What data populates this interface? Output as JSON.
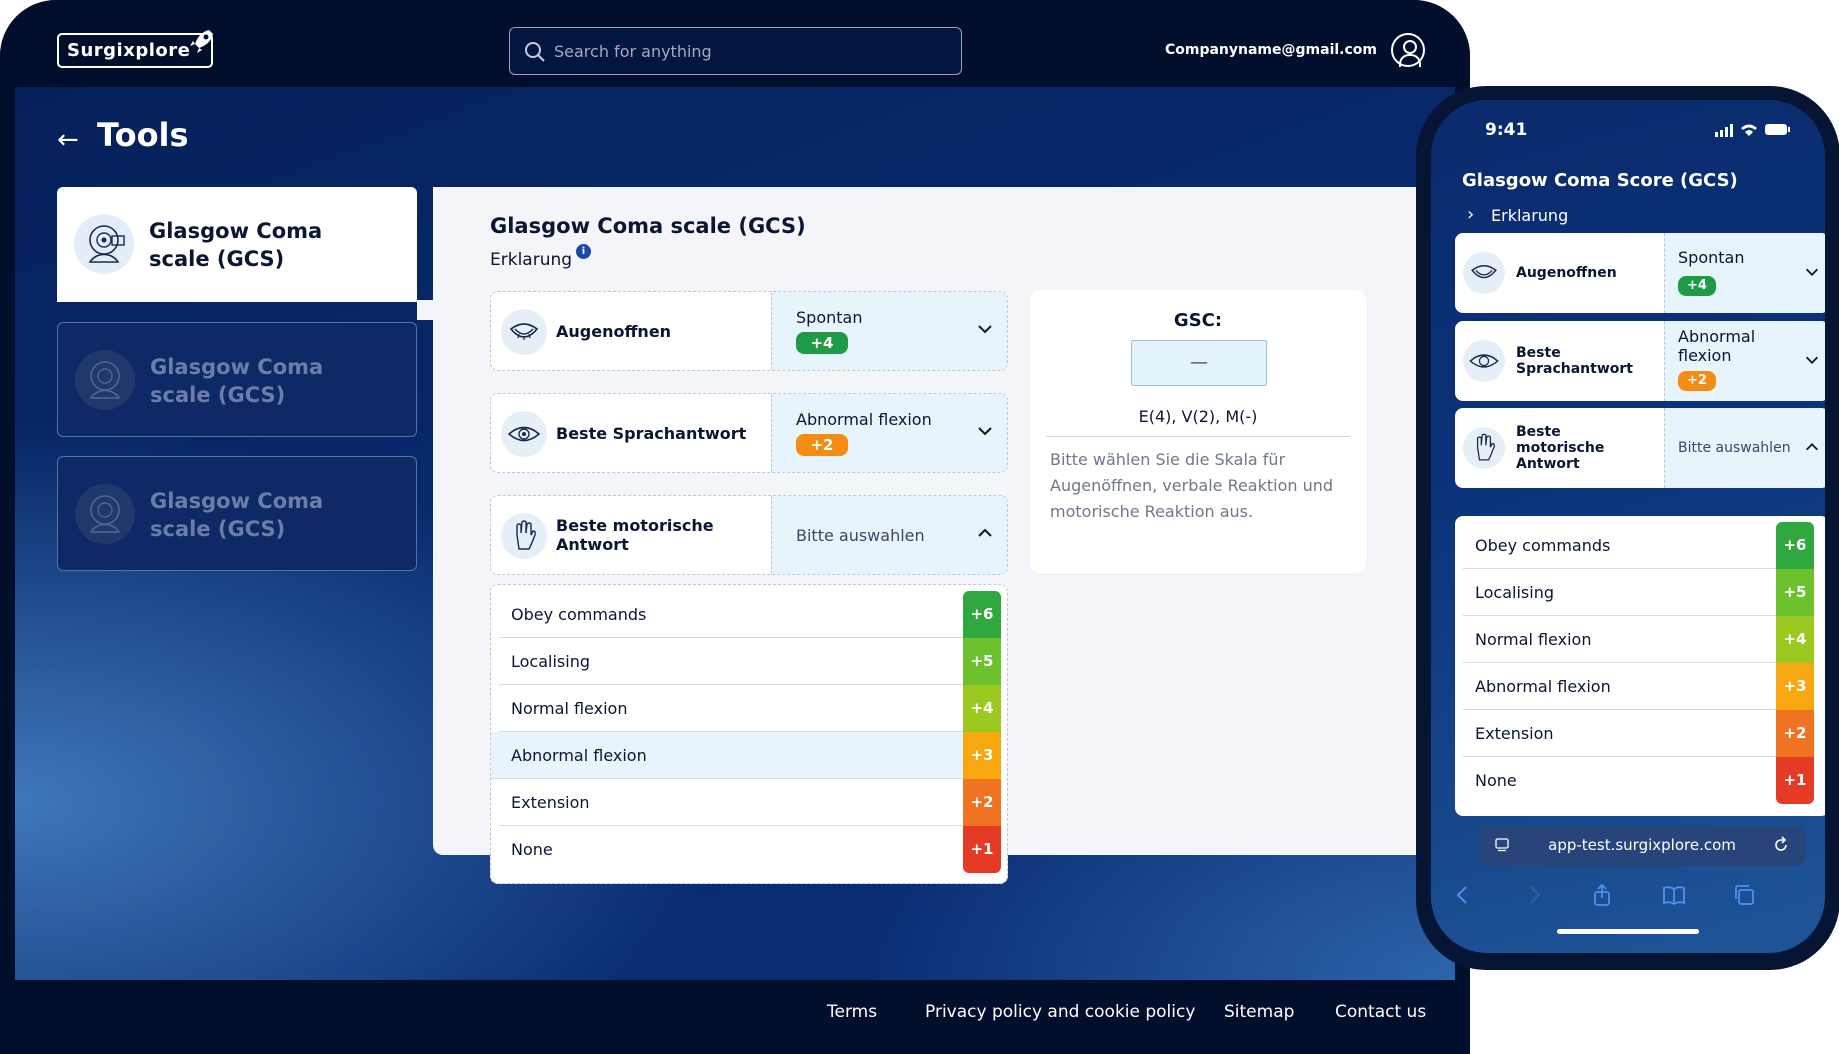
{
  "header": {
    "logo": "Surgixplore",
    "search_placeholder": "Search for anything",
    "email": "Companyname@gmail.com"
  },
  "page": {
    "title": "Tools"
  },
  "tools": [
    {
      "label": "Glasgow Coma scale (GCS)",
      "active": true
    },
    {
      "label": "Glasgow Coma scale (GCS)",
      "active": false
    },
    {
      "label": "Glasgow Coma scale (GCS)",
      "active": false
    }
  ],
  "gcs": {
    "title": "Glasgow Coma scale (GCS)",
    "subtitle": "Erklarung",
    "info_icon": "i",
    "criteria": [
      {
        "label": "Augenoffnen",
        "icon": "eye-open-icon",
        "value": "Spontan",
        "score": "+4",
        "color": "#1f9a45"
      },
      {
        "label": "Beste Sprachantwort",
        "icon": "eye-icon",
        "value": "Abnormal flexion",
        "score": "+2",
        "color": "#f28c13"
      },
      {
        "label": "Beste motorische Antwort",
        "icon": "hand-icon",
        "placeholder": "Bitte auswahlen"
      }
    ],
    "options": [
      {
        "label": "Obey commands",
        "score": "+6",
        "color": "#31a740"
      },
      {
        "label": "Localising",
        "score": "+5",
        "color": "#6ec12e"
      },
      {
        "label": "Normal flexion",
        "score": "+4",
        "color": "#9bc91f"
      },
      {
        "label": "Abnormal flexion",
        "score": "+3",
        "color": "#f7a70f"
      },
      {
        "label": "Extension",
        "score": "+2",
        "color": "#f07321"
      },
      {
        "label": "None",
        "score": "+1",
        "color": "#e53a26"
      }
    ],
    "selected_option": "Abnormal flexion"
  },
  "result": {
    "title": "GSC:",
    "value": "—",
    "summary": "E(4), V(2), M(-)",
    "hint": "Bitte wählen Sie die Skala für Augenöffnen, verbale Reaktion und motorische Reaktion aus."
  },
  "footer": {
    "links": [
      "Terms",
      "Privacy policy and cookie policy",
      "Sitemap",
      "Contact us"
    ]
  },
  "phone": {
    "time": "9:41",
    "title": "Glasgow Coma Score (GCS)",
    "subtitle": "Erklarung",
    "criteria": [
      {
        "label": "Augenoffnen",
        "value": "Spontan",
        "score": "+4",
        "color": "#1f9a45"
      },
      {
        "label": "Beste Sprachantwort",
        "value": "Abnormal flexion",
        "score": "+2",
        "color": "#f28c13"
      },
      {
        "label": "Beste motorische Antwort",
        "placeholder": "Bitte auswahlen"
      }
    ],
    "url": "app-test.surgixplore.com"
  }
}
